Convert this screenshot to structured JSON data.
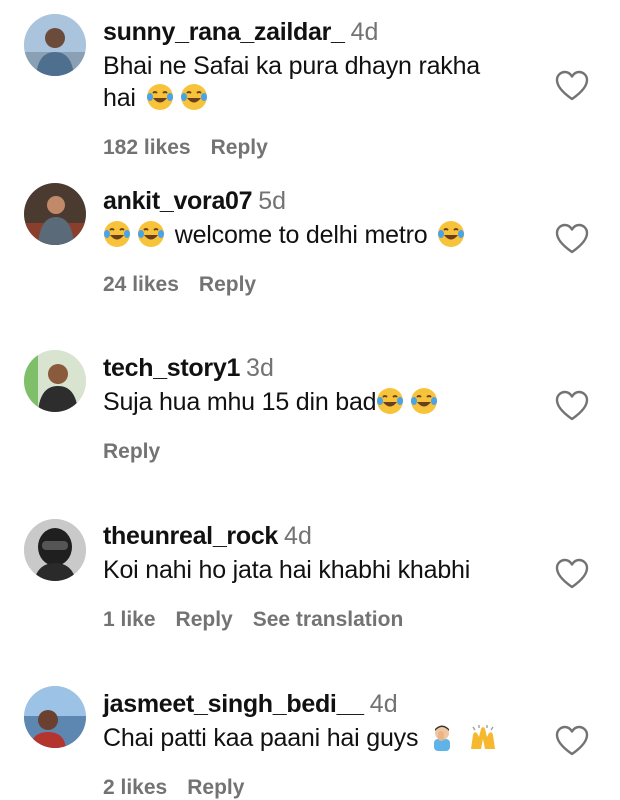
{
  "comments": [
    {
      "username": "sunny_rana_zaildar_",
      "time": "4d",
      "text_line1": "Bhai ne Safai ka pura dhayn rakha",
      "text_line2": "hai",
      "likes": "182 likes",
      "reply": "Reply"
    },
    {
      "username": "ankit_vora07",
      "time": "5d",
      "text": "welcome to delhi metro",
      "likes": "24 likes",
      "reply": "Reply"
    },
    {
      "username": "tech_story1",
      "time": "3d",
      "text": "Suja hua mhu 15 din bad",
      "reply": "Reply"
    },
    {
      "username": "theunreal_rock",
      "time": "4d",
      "text": "Koi nahi ho jata hai khabhi khabhi",
      "likes": "1 like",
      "reply": "Reply",
      "translation": "See translation"
    },
    {
      "username": "jasmeet_singh_bedi__",
      "time": "4d",
      "text": "Chai patti kaa paani hai guys",
      "likes": "2 likes",
      "reply": "Reply"
    }
  ],
  "icons": {
    "heart": "heart-outline-icon",
    "laugh": "face-with-tears-of-joy-emoji",
    "facepalm": "man-facepalming-emoji",
    "hands": "raising-hands-emoji"
  }
}
